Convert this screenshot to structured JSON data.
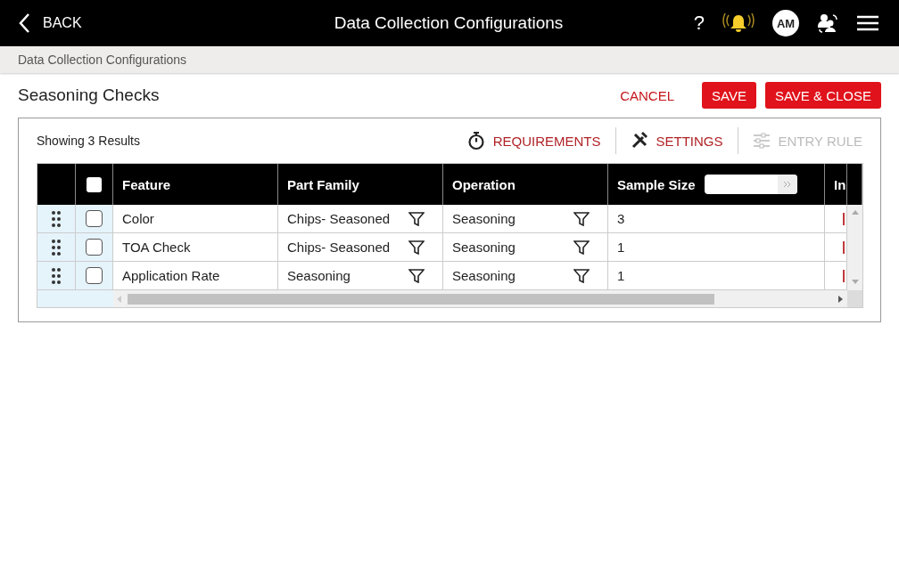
{
  "header": {
    "back": "BACK",
    "title": "Data Collection Configurations",
    "help": "?",
    "avatar": "AM"
  },
  "breadcrumb": "Data Collection Configurations",
  "page_title": "Seasoning Checks",
  "actions": [
    {
      "label": "CANCEL",
      "kind": "text"
    },
    {
      "label": "SAVE",
      "kind": "filled"
    },
    {
      "label": "SAVE & CLOSE",
      "kind": "filled"
    }
  ],
  "results": "Showing 3 Results",
  "tools": [
    {
      "label": "REQUIREMENTS",
      "kind": "timer",
      "disabled": false
    },
    {
      "label": "SETTINGS",
      "kind": "tools",
      "disabled": false
    },
    {
      "label": "ENTRY RULE",
      "kind": "sliders",
      "disabled": true
    }
  ],
  "table": {
    "columns": [
      "Feature",
      "Part Family",
      "Operation",
      "Sample Size",
      "In"
    ],
    "select_all": false,
    "rows": [
      {
        "checked": false,
        "feature": "Color",
        "part_family": "Chips- Seasoned",
        "operation": "Seasoning",
        "sample_size": "3"
      },
      {
        "checked": false,
        "feature": "TOA Check",
        "part_family": "Chips- Seasoned",
        "operation": "Seasoning",
        "sample_size": "1"
      },
      {
        "checked": false,
        "feature": "Application Rate",
        "part_family": "Seasoning",
        "operation": "Seasoning",
        "sample_size": "1"
      }
    ]
  }
}
